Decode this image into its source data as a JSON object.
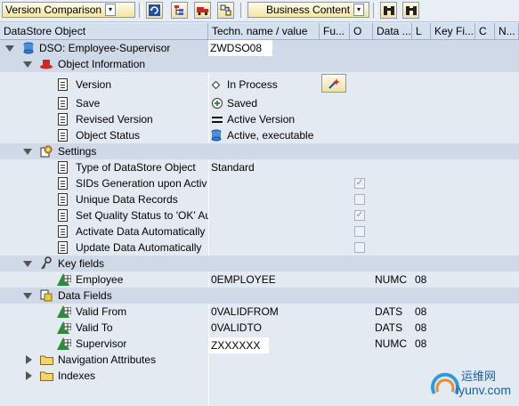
{
  "toolbar": {
    "version_comparison": "Version Comparison",
    "business_content": "Business Content"
  },
  "columns": [
    "DataStore Object",
    "Techn. name / value",
    "Fu...",
    "O",
    "Data ...",
    "L",
    "Key Fi...",
    "C",
    "N..."
  ],
  "root": {
    "label": "DSO: Employee-Supervisor",
    "value": "ZWDSO08"
  },
  "object_information": {
    "label": "Object Information",
    "version": {
      "label": "Version",
      "value": "In Process"
    },
    "save": {
      "label": "Save",
      "value": "Saved"
    },
    "revised_version": {
      "label": "Revised Version",
      "value": "Active Version"
    },
    "object_status": {
      "label": "Object Status",
      "value": "Active, executable"
    }
  },
  "settings": {
    "label": "Settings",
    "type": {
      "label": "Type of DataStore Object",
      "value": "Standard"
    },
    "sids": {
      "label": "SIDs Generation upon Activ",
      "checked": true
    },
    "unique": {
      "label": "Unique Data Records",
      "checked": false
    },
    "quality": {
      "label": "Set Quality Status to 'OK' Au",
      "checked": true
    },
    "activate": {
      "label": "Activate Data Automatically",
      "checked": false
    },
    "update": {
      "label": "Update Data Automatically",
      "checked": false
    }
  },
  "key_fields": {
    "label": "Key fields",
    "employee": {
      "label": "Employee",
      "value": "0EMPLOYEE",
      "dtype": "NUMC",
      "len": "08"
    }
  },
  "data_fields": {
    "label": "Data Fields",
    "valid_from": {
      "label": "Valid From",
      "value": "0VALIDFROM",
      "dtype": "DATS",
      "len": "08"
    },
    "valid_to": {
      "label": "Valid To",
      "value": "0VALIDTO",
      "dtype": "DATS",
      "len": "08"
    },
    "supervisor": {
      "label": "Supervisor",
      "value": "ZXXXXXX",
      "dtype": "NUMC",
      "len": "08"
    }
  },
  "navigation_attributes": {
    "label": "Navigation Attributes"
  },
  "indexes": {
    "label": "Indexes"
  },
  "watermark": {
    "cn": "运维网",
    "url": "iyunv.com"
  }
}
